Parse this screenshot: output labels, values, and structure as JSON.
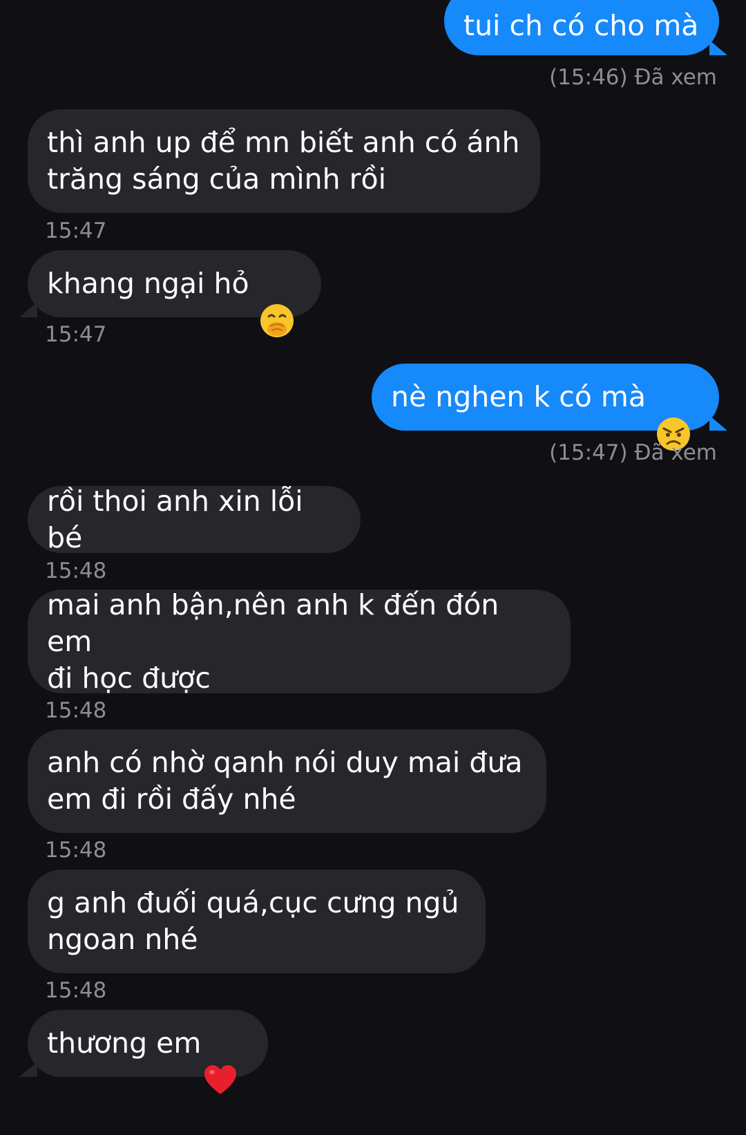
{
  "messages": [
    {
      "id": "m1",
      "side": "sent",
      "text": "tui ch có cho mà",
      "status": "(15:46) Đã xem"
    },
    {
      "id": "m2",
      "side": "recv",
      "text": "thì anh up để mn biết anh có ánh\ntrăng sáng của mình rồi",
      "time": "15:47"
    },
    {
      "id": "m3",
      "side": "recv",
      "text": "khang ngại hỏ",
      "emoji": "face-with-hand-over-mouth-icon",
      "time": "15:47"
    },
    {
      "id": "m4",
      "side": "sent",
      "text": "nè nghen k có mà",
      "emoji": "angry-face-icon",
      "status": "(15:47) Đã xem"
    },
    {
      "id": "m5",
      "side": "recv",
      "text": "rồi thoi anh xin lỗi bé",
      "time": "15:48"
    },
    {
      "id": "m6",
      "side": "recv",
      "text": "mai anh bận,nên anh k đến đón em\nđi học được",
      "time": "15:48"
    },
    {
      "id": "m7",
      "side": "recv",
      "text": "anh có nhờ qanh nói duy mai đưa\nem đi rồi đấy nhé",
      "time": "15:48"
    },
    {
      "id": "m8",
      "side": "recv",
      "text": "g anh đuối quá,cục cưng ngủ\nngoan nhé",
      "time": "15:48"
    },
    {
      "id": "m9",
      "side": "recv",
      "text": "thương em",
      "emoji": "red-heart-icon"
    }
  ],
  "colors": {
    "background": "#0f0f14",
    "sent_bubble": "#1689fb",
    "received_bubble": "#26262b",
    "meta_text": "#8d8d93"
  }
}
